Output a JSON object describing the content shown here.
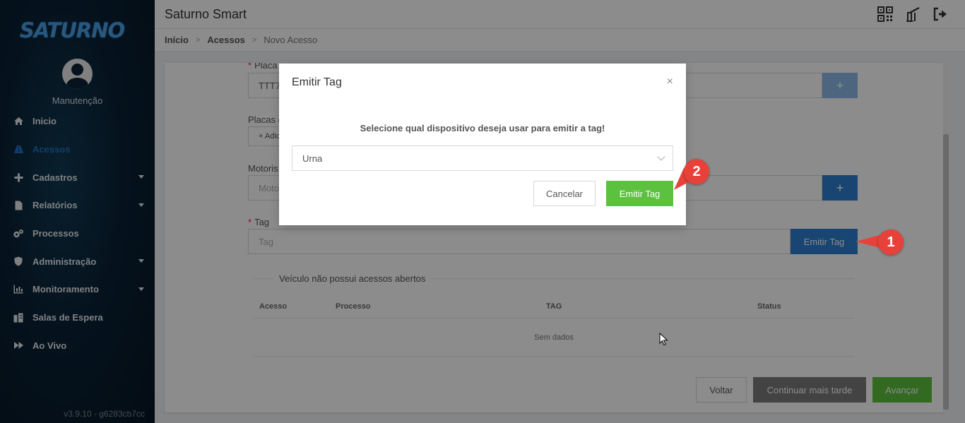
{
  "app": {
    "title": "Saturno Smart",
    "logo_text": "SATURNO"
  },
  "sidebar": {
    "username": "Manutenção",
    "version": "v3.9.10 - g6283cb7cc",
    "items": [
      {
        "label": "Inicio",
        "icon": "home-icon",
        "active": false,
        "has_caret": false
      },
      {
        "label": "Acessos",
        "icon": "road-icon",
        "active": true,
        "has_caret": false
      },
      {
        "label": "Cadastros",
        "icon": "plus-icon",
        "active": false,
        "has_caret": true
      },
      {
        "label": "Relatórios",
        "icon": "file-icon",
        "active": false,
        "has_caret": true
      },
      {
        "label": "Processos",
        "icon": "gears-icon",
        "active": false,
        "has_caret": false
      },
      {
        "label": "Administração",
        "icon": "shield-icon",
        "active": false,
        "has_caret": true
      },
      {
        "label": "Monitoramento",
        "icon": "chart-icon",
        "active": false,
        "has_caret": true
      },
      {
        "label": "Salas de Espera",
        "icon": "building-icon",
        "active": false,
        "has_caret": false
      },
      {
        "label": "Ao Vivo",
        "icon": "forward-icon",
        "active": false,
        "has_caret": false
      }
    ]
  },
  "header_icons": [
    "qrcode-icon",
    "boom-barrier-icon",
    "logout-icon"
  ],
  "breadcrumb": {
    "items": [
      "Início",
      "Acessos",
      "Novo Acesso"
    ]
  },
  "form": {
    "placa_label": "Placa",
    "placa_value": "TTT7",
    "placas_label": "Placas c",
    "placas_button": "+ Adici",
    "motorista_label": "Motoris",
    "motorista_placeholder": "Moto",
    "tag_label": "Tag",
    "tag_placeholder": "Tag",
    "emit_tag_button": "Emitir Tag",
    "plus_symbol": "+"
  },
  "accesses": {
    "divider_label": "Veículo não possui acessos abertos",
    "columns": [
      "Acesso",
      "Processo",
      "TAG",
      "Status"
    ],
    "empty_text": "Sem dados"
  },
  "footer_buttons": {
    "back": "Voltar",
    "continue_later": "Continuar mais tarde",
    "next": "Avançar"
  },
  "modal": {
    "title": "Emitir Tag",
    "close_symbol": "×",
    "message": "Selecione qual dispositivo deseja usar para emitir a tag!",
    "select_value": "Urna",
    "cancel_label": "Cancelar",
    "confirm_label": "Emitir Tag"
  },
  "annotations": {
    "marker_1": "1",
    "marker_2": "2",
    "color": "#e8413a"
  },
  "colors": {
    "primary_blue": "#2f7fd0",
    "success_green": "#5cc13f",
    "sidebar_bg": "#0a2236"
  }
}
